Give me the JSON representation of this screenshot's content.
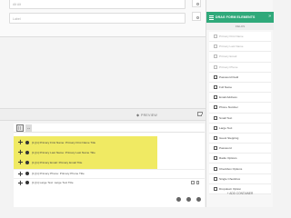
{
  "form": {
    "inputs": [
      {
        "placeholder": "Alt Alt"
      },
      {
        "placeholder": "Label"
      }
    ]
  },
  "preview": {
    "label": "PREVIEW"
  },
  "field_list": {
    "rows": [
      {
        "text": "[1] [1] Primary First Name: Primary First Name Title",
        "highlighted": true
      },
      {
        "text": "[1] [1] Primary Last Name: Primary Last Name Title",
        "highlighted": true
      },
      {
        "text": "[1] [1] Primary Email: Primary Email Title",
        "highlighted": true
      },
      {
        "text": "[1] [1] Primary Phone: Primary Phone Title",
        "highlighted": false
      },
      {
        "text": "[1] [1] Large Text: Large Text Title",
        "highlighted": false
      }
    ]
  },
  "right_panel": {
    "title": "DRAG FORM ELEMENTS",
    "list_label": "FIELDS",
    "items": [
      {
        "label": "Primary First Name",
        "disabled": true
      },
      {
        "label": "Primary Last Name",
        "disabled": true
      },
      {
        "label": "Primary Email",
        "disabled": true
      },
      {
        "label": "Primary Phone",
        "disabled": true
      },
      {
        "label": "Password Field",
        "disabled": false
      },
      {
        "label": "Full Name",
        "disabled": false
      },
      {
        "label": "Email Address",
        "disabled": false
      },
      {
        "label": "Phone Number",
        "disabled": false
      },
      {
        "label": "Small Text",
        "disabled": false
      },
      {
        "label": "Large Text",
        "disabled": false
      },
      {
        "label": "Guest Stepping",
        "disabled": false
      },
      {
        "label": "Password",
        "disabled": false
      },
      {
        "label": "Radio Options",
        "disabled": false
      },
      {
        "label": "Checkbox Options",
        "disabled": false
      },
      {
        "label": "Single Checkbox",
        "disabled": false
      },
      {
        "label": "Dropdown Option",
        "disabled": false
      }
    ],
    "add_container": "+ ADD CONTAINER"
  },
  "colors": {
    "accent": "#2fa97a",
    "highlight": "#f0ea63"
  }
}
